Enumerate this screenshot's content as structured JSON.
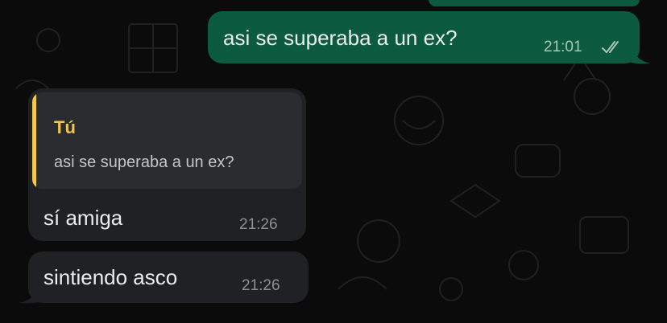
{
  "chat": {
    "messages": [
      {
        "direction": "outgoing",
        "text": "asi se superaba a un ex?",
        "time": "21:01",
        "status": "read"
      },
      {
        "direction": "incoming",
        "reply_to": {
          "author": "Tú",
          "text": "asi se superaba a un ex?"
        },
        "text": "sí amiga",
        "time": "21:26"
      },
      {
        "direction": "incoming",
        "text": "sintiendo asco",
        "time": "21:26"
      }
    ]
  },
  "colors": {
    "background": "#0b0b0b",
    "outgoing_bubble": "#0c5a3f",
    "incoming_bubble": "#1f2124",
    "quote_accent": "#f2c94c"
  },
  "icons": {
    "read_receipt": "double-check-icon"
  }
}
